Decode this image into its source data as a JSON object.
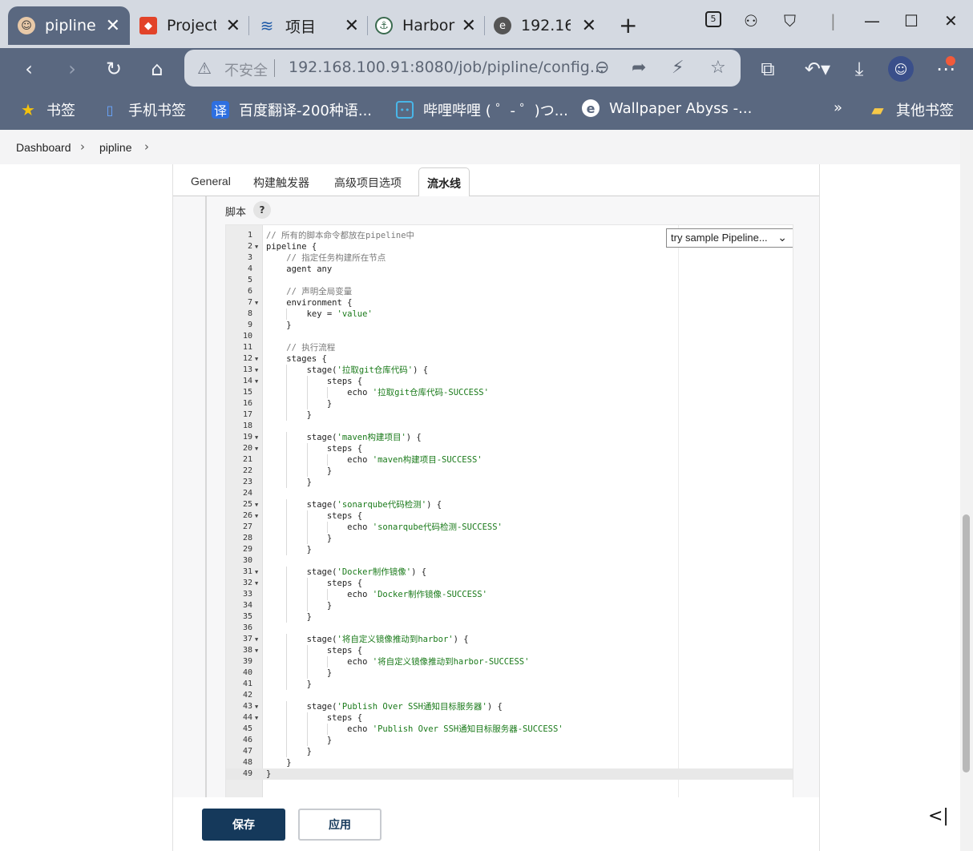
{
  "browser": {
    "tabs": [
      {
        "title": "pipline",
        "active": true
      },
      {
        "title": "Project",
        "active": false
      },
      {
        "title": "项目",
        "active": false
      },
      {
        "title": "Harbor",
        "active": false
      },
      {
        "title": "192.16",
        "active": false
      }
    ],
    "new_tab": "+",
    "address": {
      "security_label": "不安全",
      "url": "192.168.100.91:8080/job/pipline/config..."
    },
    "bookmarks": [
      {
        "label": "书签",
        "icon": "star-icon"
      },
      {
        "label": "手机书签",
        "icon": "phone-icon"
      },
      {
        "label": "百度翻译-200种语...",
        "icon": "translate-icon"
      },
      {
        "label": "哔哩哔哩 ( ゜- ゜)つ...",
        "icon": "bilibili-icon"
      },
      {
        "label": "Wallpaper Abyss -...",
        "icon": "edge-icon"
      },
      {
        "label": "»",
        "icon": ""
      },
      {
        "label": "其他书签",
        "icon": "folder-icon"
      }
    ]
  },
  "breadcrumb": {
    "items": [
      "Dashboard",
      "pipline"
    ]
  },
  "config_tabs": [
    "General",
    "构建触发器",
    "高级项目选项",
    "流水线"
  ],
  "pipeline": {
    "script_label": "脚本",
    "help": "?",
    "sample_select": "try sample Pipeline...",
    "lines": [
      {
        "n": "1",
        "t": "// 所有的脚本命令都放在pipeline中",
        "k": "comment"
      },
      {
        "n": "2",
        "t": "pipeline {",
        "f": true
      },
      {
        "n": "3",
        "t": "    // 指定任务构建所在节点",
        "k": "comment"
      },
      {
        "n": "4",
        "t": "    agent any"
      },
      {
        "n": "5",
        "t": ""
      },
      {
        "n": "6",
        "t": "    // 声明全局变量",
        "k": "comment"
      },
      {
        "n": "7",
        "t": "    environment {",
        "f": true
      },
      {
        "n": "8",
        "t": "        key = 'value'"
      },
      {
        "n": "9",
        "t": "    }"
      },
      {
        "n": "10",
        "t": ""
      },
      {
        "n": "11",
        "t": "    // 执行流程",
        "k": "comment"
      },
      {
        "n": "12",
        "t": "    stages {",
        "f": true
      },
      {
        "n": "13",
        "t": "        stage('拉取git仓库代码') {",
        "f": true
      },
      {
        "n": "14",
        "t": "            steps {",
        "f": true
      },
      {
        "n": "15",
        "t": "                echo '拉取git仓库代码-SUCCESS'"
      },
      {
        "n": "16",
        "t": "            }"
      },
      {
        "n": "17",
        "t": "        }"
      },
      {
        "n": "18",
        "t": ""
      },
      {
        "n": "19",
        "t": "        stage('maven构建项目') {",
        "f": true
      },
      {
        "n": "20",
        "t": "            steps {",
        "f": true
      },
      {
        "n": "21",
        "t": "                echo 'maven构建项目-SUCCESS'"
      },
      {
        "n": "22",
        "t": "            }"
      },
      {
        "n": "23",
        "t": "        }"
      },
      {
        "n": "24",
        "t": ""
      },
      {
        "n": "25",
        "t": "        stage('sonarqube代码检测') {",
        "f": true
      },
      {
        "n": "26",
        "t": "            steps {",
        "f": true
      },
      {
        "n": "27",
        "t": "                echo 'sonarqube代码检测-SUCCESS'"
      },
      {
        "n": "28",
        "t": "            }"
      },
      {
        "n": "29",
        "t": "        }"
      },
      {
        "n": "30",
        "t": ""
      },
      {
        "n": "31",
        "t": "        stage('Docker制作镜像') {",
        "f": true
      },
      {
        "n": "32",
        "t": "            steps {",
        "f": true
      },
      {
        "n": "33",
        "t": "                echo 'Docker制作镜像-SUCCESS'"
      },
      {
        "n": "34",
        "t": "            }"
      },
      {
        "n": "35",
        "t": "        }"
      },
      {
        "n": "36",
        "t": ""
      },
      {
        "n": "37",
        "t": "        stage('将自定义镜像推动到harbor') {",
        "f": true
      },
      {
        "n": "38",
        "t": "            steps {",
        "f": true
      },
      {
        "n": "39",
        "t": "                echo '将自定义镜像推动到harbor-SUCCESS'"
      },
      {
        "n": "40",
        "t": "            }"
      },
      {
        "n": "41",
        "t": "        }"
      },
      {
        "n": "42",
        "t": ""
      },
      {
        "n": "43",
        "t": "        stage('Publish Over SSH通知目标服务器') {",
        "f": true
      },
      {
        "n": "44",
        "t": "            steps {",
        "f": true
      },
      {
        "n": "45",
        "t": "                echo 'Publish Over SSH通知目标服务器-SUCCESS'"
      },
      {
        "n": "46",
        "t": "            }"
      },
      {
        "n": "47",
        "t": "        }"
      },
      {
        "n": "48",
        "t": "    }"
      },
      {
        "n": "49",
        "t": "}",
        "hl": true
      }
    ]
  },
  "buttons": {
    "save": "保存",
    "apply": "应用"
  },
  "colors": {
    "chrome": "#5a6880",
    "tabstrip": "#d4d9e1",
    "primary_button": "#15395b",
    "string": "#1a7a1a",
    "comment": "#7a7a7a"
  }
}
